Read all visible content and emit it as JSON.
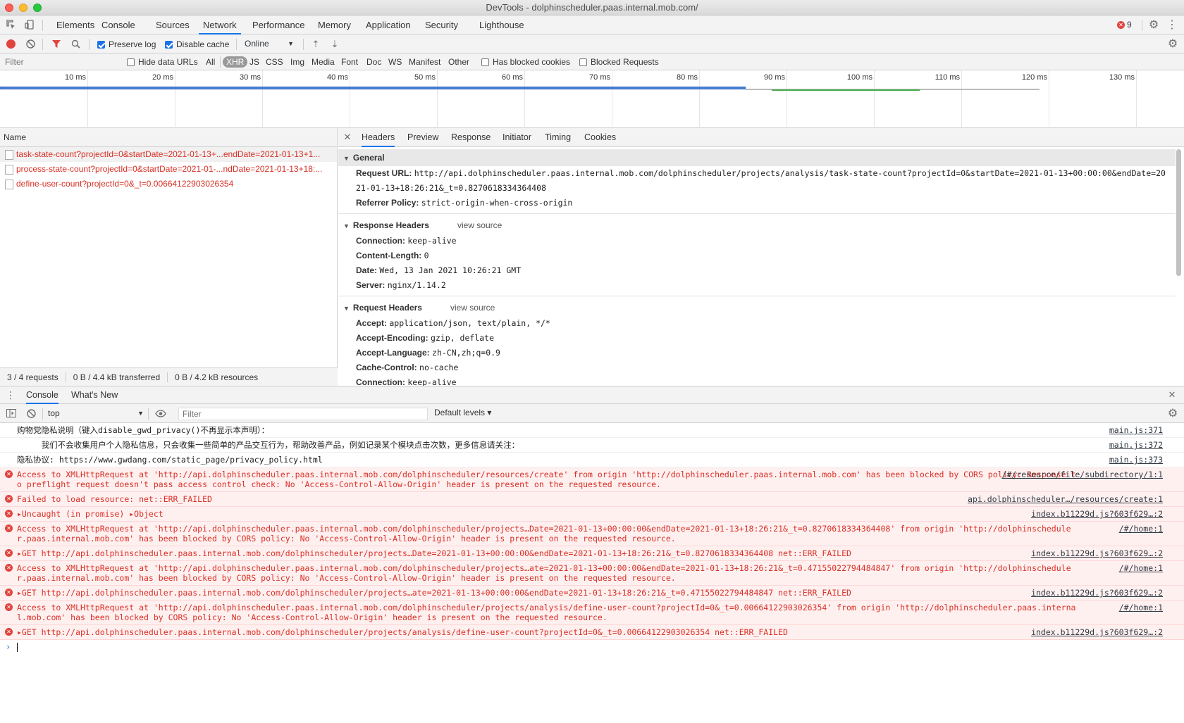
{
  "window": {
    "title": "DevTools - dolphinscheduler.paas.internal.mob.com/"
  },
  "main_tabs": [
    "Elements",
    "Console",
    "Sources",
    "Network",
    "Performance",
    "Memory",
    "Application",
    "Security",
    "Lighthouse"
  ],
  "error_badge": "9",
  "toolbar": {
    "preserve_log": "Preserve log",
    "disable_cache": "Disable cache",
    "throttle": "Online"
  },
  "filterbar": {
    "placeholder": "Filter",
    "hide_data_urls": "Hide data URLs",
    "types": [
      "All",
      "XHR",
      "JS",
      "CSS",
      "Img",
      "Media",
      "Font",
      "Doc",
      "WS",
      "Manifest",
      "Other"
    ],
    "has_blocked_cookies": "Has blocked cookies",
    "blocked_requests": "Blocked Requests"
  },
  "timeline": {
    "ticks": [
      "10 ms",
      "20 ms",
      "30 ms",
      "40 ms",
      "50 ms",
      "60 ms",
      "70 ms",
      "80 ms",
      "90 ms",
      "100 ms",
      "110 ms",
      "120 ms",
      "130 ms"
    ]
  },
  "requests": {
    "header": "Name",
    "rows": [
      "task-state-count?projectId=0&startDate=2021-01-13+...endDate=2021-01-13+1...",
      "process-state-count?projectId=0&startDate=2021-01-...ndDate=2021-01-13+18:...",
      "define-user-count?projectId=0&_t=0.00664122903026354"
    ],
    "status": [
      "3 / 4 requests",
      "0 B / 4.4 kB transferred",
      "0 B / 4.2 kB resources"
    ]
  },
  "detail": {
    "tabs": [
      "Headers",
      "Preview",
      "Response",
      "Initiator",
      "Timing",
      "Cookies"
    ],
    "general": {
      "title": "General",
      "request_url_key": "Request URL:",
      "request_url": "http://api.dolphinscheduler.paas.internal.mob.com/dolphinscheduler/projects/analysis/task-state-count?projectId=0&startDate=2021-01-13+00:00:00&endDate=2021-01-13+18:26:21&_t=0.8270618334364408",
      "referrer_key": "Referrer Policy:",
      "referrer": "strict-origin-when-cross-origin"
    },
    "response_headers": {
      "title": "Response Headers",
      "view_source": "view source",
      "items": [
        {
          "k": "Connection:",
          "v": "keep-alive"
        },
        {
          "k": "Content-Length:",
          "v": "0"
        },
        {
          "k": "Date:",
          "v": "Wed, 13 Jan 2021 10:26:21 GMT"
        },
        {
          "k": "Server:",
          "v": "nginx/1.14.2"
        }
      ]
    },
    "request_headers": {
      "title": "Request Headers",
      "view_source": "view source",
      "items": [
        {
          "k": "Accept:",
          "v": "application/json, text/plain, */*"
        },
        {
          "k": "Accept-Encoding:",
          "v": "gzip, deflate"
        },
        {
          "k": "Accept-Language:",
          "v": "zh-CN,zh;q=0.9"
        },
        {
          "k": "Cache-Control:",
          "v": "no-cache"
        },
        {
          "k": "Connection:",
          "v": "keep-alive"
        }
      ]
    }
  },
  "drawer": {
    "tabs": [
      "Console",
      "What's New"
    ],
    "context": "top",
    "filter_placeholder": "Filter",
    "levels": "Default levels ▾"
  },
  "console": {
    "messages": [
      {
        "type": "log",
        "text": "购物党隐私说明（键入disable_gwd_privacy()不再显示本声明）：",
        "src": "main.js:371"
      },
      {
        "type": "log",
        "text": "     我们不会收集用户个人隐私信息，只会收集一些简单的产品交互行为，帮助改善产品，例如记录某个模块点击次数，更多信息请关注：",
        "src": "main.js:372"
      },
      {
        "type": "log",
        "text": "隐私协议: https://www.gwdang.com/static_page/privacy_policy.html",
        "src": "main.js:373"
      },
      {
        "type": "err",
        "text": "Access to XMLHttpRequest at 'http://api.dolphinscheduler.paas.internal.mob.com/dolphinscheduler/resources/create' from origin 'http://dolphinscheduler.paas.internal.mob.com' has been blocked by CORS policy: Response to preflight request doesn't pass access control check: No 'Access-Control-Allow-Origin' header is present on the requested resource.",
        "src": "/#/resource/file/subdirectory/1:1"
      },
      {
        "type": "err",
        "text": "Failed to load resource: net::ERR_FAILED",
        "src": "api.dolphinscheduler…/resources/create:1"
      },
      {
        "type": "err",
        "text": "▸Uncaught (in promise) ▸Object",
        "src": "index.b11229d.js?603f629…:2"
      },
      {
        "type": "err",
        "text": "Access to XMLHttpRequest at 'http://api.dolphinscheduler.paas.internal.mob.com/dolphinscheduler/projects…Date=2021-01-13+00:00:00&endDate=2021-01-13+18:26:21&_t=0.8270618334364408' from origin 'http://dolphinscheduler.paas.internal.mob.com' has been blocked by CORS policy: No 'Access-Control-Allow-Origin' header is present on the requested resource.",
        "src": "/#/home:1"
      },
      {
        "type": "err",
        "text": "▸GET http://api.dolphinscheduler.paas.internal.mob.com/dolphinscheduler/projects…Date=2021-01-13+00:00:00&endDate=2021-01-13+18:26:21&_t=0.8270618334364408 net::ERR_FAILED",
        "src": "index.b11229d.js?603f629…:2"
      },
      {
        "type": "err",
        "text": "Access to XMLHttpRequest at 'http://api.dolphinscheduler.paas.internal.mob.com/dolphinscheduler/projects…ate=2021-01-13+00:00:00&endDate=2021-01-13+18:26:21&_t=0.47155022794484847' from origin 'http://dolphinscheduler.paas.internal.mob.com' has been blocked by CORS policy: No 'Access-Control-Allow-Origin' header is present on the requested resource.",
        "src": "/#/home:1"
      },
      {
        "type": "err",
        "text": "▸GET http://api.dolphinscheduler.paas.internal.mob.com/dolphinscheduler/projects…ate=2021-01-13+00:00:00&endDate=2021-01-13+18:26:21&_t=0.47155022794484847 net::ERR_FAILED",
        "src": "index.b11229d.js?603f629…:2"
      },
      {
        "type": "err",
        "text": "Access to XMLHttpRequest at 'http://api.dolphinscheduler.paas.internal.mob.com/dolphinscheduler/projects/analysis/define-user-count?projectId=0&_t=0.00664122903026354' from origin 'http://dolphinscheduler.paas.internal.mob.com' has been blocked by CORS policy: No 'Access-Control-Allow-Origin' header is present on the requested resource.",
        "src": "/#/home:1"
      },
      {
        "type": "err",
        "text": "▸GET http://api.dolphinscheduler.paas.internal.mob.com/dolphinscheduler/projects/analysis/define-user-count?projectId=0&_t=0.00664122903026354 net::ERR_FAILED",
        "src": "index.b11229d.js?603f629…:2"
      }
    ]
  },
  "colors": {
    "accent": "#1a73e8",
    "error": "#d93025",
    "error_bg": "#fff0f0"
  }
}
